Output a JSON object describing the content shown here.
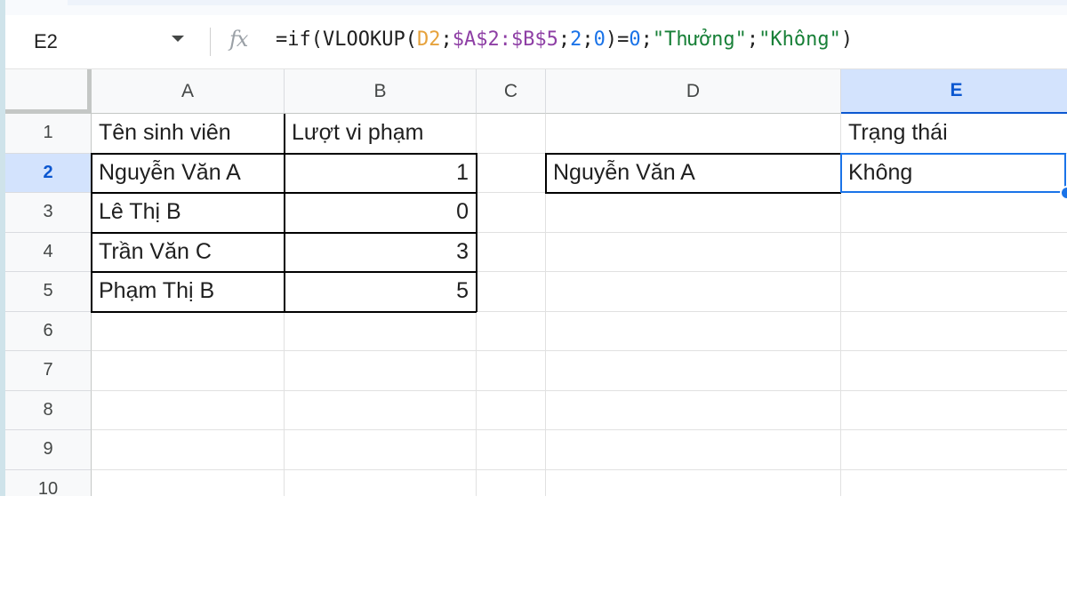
{
  "name_box": "E2",
  "formula": {
    "parts": [
      {
        "text": "=if(VLOOKUP(",
        "cls": ""
      },
      {
        "text": "D2",
        "cls": "f-ref1"
      },
      {
        "text": ";",
        "cls": ""
      },
      {
        "text": "$A$2:$B$5",
        "cls": "f-ref2"
      },
      {
        "text": ";",
        "cls": ""
      },
      {
        "text": "2",
        "cls": "f-num"
      },
      {
        "text": ";",
        "cls": ""
      },
      {
        "text": "0",
        "cls": "f-num"
      },
      {
        "text": ")=",
        "cls": ""
      },
      {
        "text": "0",
        "cls": "f-num"
      },
      {
        "text": ";",
        "cls": ""
      },
      {
        "text": "\"Thưởng\"",
        "cls": "f-str"
      },
      {
        "text": ";",
        "cls": ""
      },
      {
        "text": "\"Không\"",
        "cls": "f-str"
      },
      {
        "text": ")",
        "cls": ""
      }
    ]
  },
  "fx_icon": "fx-icon",
  "columns": [
    "A",
    "B",
    "C",
    "D",
    "E"
  ],
  "active_column": "E",
  "rows": [
    "1",
    "2",
    "3",
    "4",
    "5",
    "6",
    "7",
    "8",
    "9",
    "10"
  ],
  "active_row": "2",
  "cells": [
    {
      "ref": "A1",
      "value": "Tên sinh viên"
    },
    {
      "ref": "B1",
      "value": "Lượt vi phạm"
    },
    {
      "ref": "E1",
      "value": "Trạng thái"
    },
    {
      "ref": "A2",
      "value": "Nguyễn Văn A"
    },
    {
      "ref": "B2",
      "value": "1",
      "numeric": true
    },
    {
      "ref": "D2",
      "value": "Nguyễn Văn A"
    },
    {
      "ref": "E2",
      "value": "Không"
    },
    {
      "ref": "A3",
      "value": "Lê Thị B"
    },
    {
      "ref": "B3",
      "value": "0",
      "numeric": true
    },
    {
      "ref": "A4",
      "value": "Trần Văn C"
    },
    {
      "ref": "B4",
      "value": "3",
      "numeric": true
    },
    {
      "ref": "A5",
      "value": "Phạm Thị B"
    },
    {
      "ref": "B5",
      "value": "5",
      "numeric": true
    }
  ],
  "selected_cell": "E2",
  "colors": {
    "selection": "#1a73e8",
    "header_active_bg": "#d3e3fd",
    "header_active_text": "#0b57d0"
  }
}
